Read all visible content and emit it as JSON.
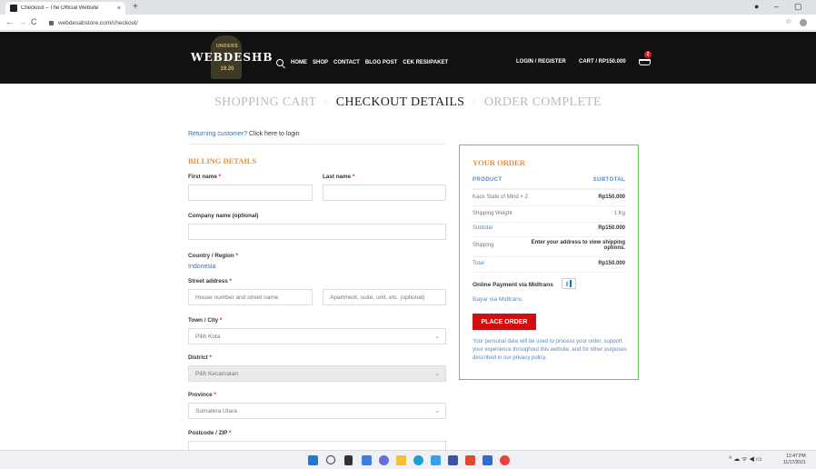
{
  "browser": {
    "tab_title": "Checkout – The Official Website",
    "tab_close": "×",
    "new_tab": "+",
    "url": "webdesabstore.com/checkout/",
    "back": "←",
    "forward": "→",
    "reload": "C",
    "bookmark": "☆",
    "min": "–",
    "max": "▢",
    "profile": "●"
  },
  "header": {
    "logo_top": "UNDERS",
    "logo_main": "WEBDESHB",
    "logo_sub": "19.20",
    "nav": [
      "HOME",
      "SHOP",
      "CONTACT",
      "BLOG POST",
      "CEK RESI/PAKET"
    ],
    "login": "LOGIN / REGISTER",
    "cart": "CART / RP150.000",
    "cart_count": "2"
  },
  "steps": {
    "cart": "SHOPPING CART",
    "checkout": "CHECKOUT DETAILS",
    "complete": "ORDER COMPLETE",
    "sep": ">"
  },
  "returning": {
    "prefix": "Returning customer?",
    "link": "Click here to login"
  },
  "billing": {
    "title": "BILLING DETAILS",
    "req": "*",
    "first_name": "First name",
    "last_name": "Last name",
    "company": "Company name (optional)",
    "country": "Country / Region",
    "country_value": "Indonesia",
    "street": "Street address",
    "street_ph1": "House number and street name",
    "street_ph2": "Apartment, suite, unit, etc. (optional)",
    "town": "Town / City",
    "town_value": "Pilih Kota",
    "district": "District",
    "district_value": "Pilih Kecamatan",
    "province": "Province",
    "province_value": "Sumatera Utara",
    "postcode": "Postcode / ZIP",
    "chevron": "⌄"
  },
  "order": {
    "title": "YOUR ORDER",
    "col_product": "PRODUCT",
    "col_subtotal": "SUBTOTAL",
    "item_name": "Kaos State of Mind × 2",
    "item_price": "Rp150.000",
    "weight_label": "Shipping Weight",
    "weight_value": "1 Kg",
    "subtotal_label": "Subtotal",
    "subtotal_value": "Rp150.000",
    "shipping_label": "Shipping",
    "shipping_note": "Enter your address to view shipping options.",
    "total_label": "Total",
    "total_value": "Rp150.000",
    "payment_label": "Online Payment via Midtrans",
    "payment_desc": "Bayar via Midtrans.",
    "place_order": "PLACE ORDER",
    "privacy": "Your personal data will be used to process your order, support your experience throughout this website, and for other purposes described in our privacy policy."
  },
  "taskbar": {
    "time": "12:47 PM",
    "date": "11/17/2021",
    "tray": "^ ☁ ᯤ ◀ ▭"
  },
  "colors": {
    "accent_orange": "#e8902e",
    "order_border": "#5fcf4d",
    "button_red": "#d01010",
    "link_blue": "#3a6fa8"
  }
}
